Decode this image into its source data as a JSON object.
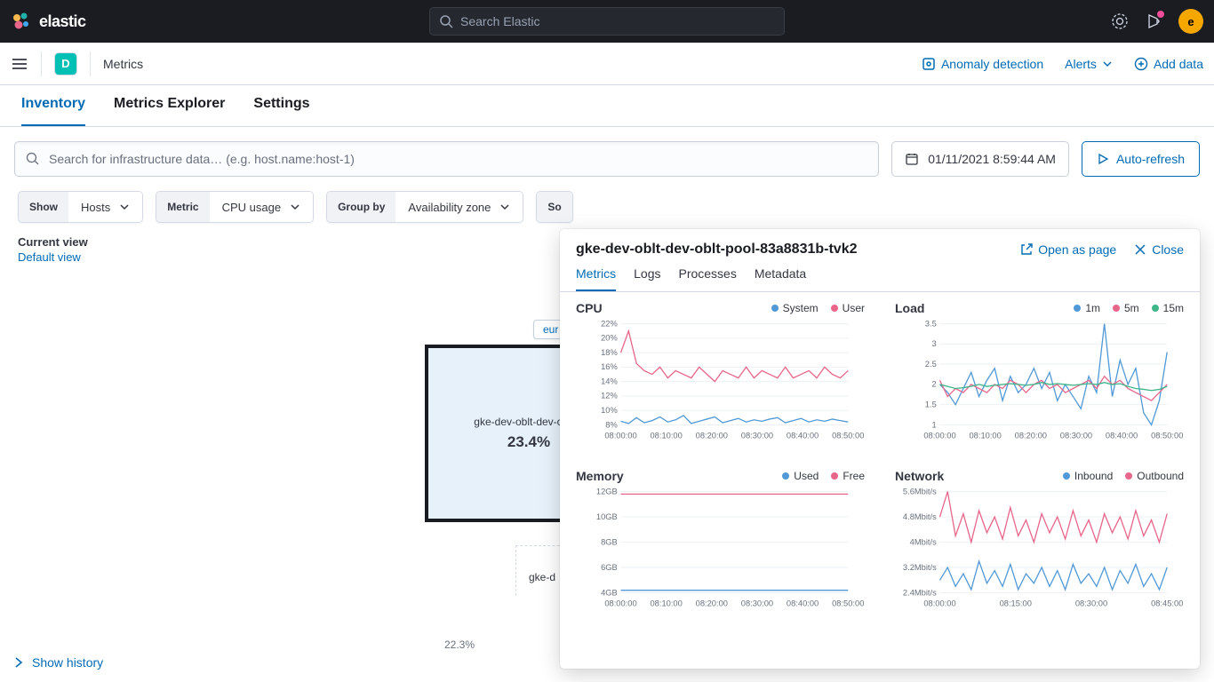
{
  "header": {
    "brand": "elastic",
    "search_placeholder": "Search Elastic",
    "avatar_letter": "e"
  },
  "subheader": {
    "space_letter": "D",
    "breadcrumb": "Metrics",
    "anomaly": "Anomaly detection",
    "alerts": "Alerts",
    "add_data": "Add data"
  },
  "tabs": {
    "inventory": "Inventory",
    "explorer": "Metrics Explorer",
    "settings": "Settings"
  },
  "filter": {
    "search_placeholder": "Search for infrastructure data… (e.g. host.name:host-1)",
    "date": "01/11/2021 8:59:44 AM",
    "refresh": "Auto-refresh"
  },
  "controls": {
    "show_label": "Show",
    "show_value": "Hosts",
    "metric_label": "Metric",
    "metric_value": "CPU usage",
    "group_label": "Group by",
    "group_value": "Availability zone",
    "sort_label": "So"
  },
  "view": {
    "label": "Current view",
    "link": "Default view"
  },
  "waffle": {
    "zone": "eur",
    "node_name": "gke-dev-oblt-dev-oblt-p",
    "node_value": "23.4%",
    "node2_name": "gke-d",
    "pct2": "22.3%"
  },
  "history": "Show history",
  "flyout": {
    "title": "gke-dev-oblt-dev-oblt-pool-83a8831b-tvk2",
    "open": "Open as page",
    "close": "Close",
    "tabs": {
      "metrics": "Metrics",
      "logs": "Logs",
      "processes": "Processes",
      "metadata": "Metadata"
    },
    "cpu": {
      "title": "CPU",
      "legend": [
        "System",
        "User"
      ]
    },
    "load": {
      "title": "Load",
      "legend": [
        "1m",
        "5m",
        "15m"
      ]
    },
    "memory": {
      "title": "Memory",
      "legend": [
        "Used",
        "Free"
      ]
    },
    "network": {
      "title": "Network",
      "legend": [
        "Inbound",
        "Outbound"
      ]
    }
  },
  "colors": {
    "blue": "#5199d6",
    "pink": "#e7668a",
    "green": "#3fb58a"
  },
  "chart_data": [
    {
      "type": "line",
      "title": "CPU",
      "xlabel": "",
      "ylabel": "",
      "x_ticks": [
        "08:00:00",
        "08:10:00",
        "08:20:00",
        "08:30:00",
        "08:40:00",
        "08:50:00"
      ],
      "y_ticks": [
        "8%",
        "10%",
        "12%",
        "14%",
        "16%",
        "18%",
        "20%",
        "22%"
      ],
      "ylim": [
        8,
        22
      ],
      "series": [
        {
          "name": "System",
          "color": "#5199d6",
          "values": [
            8.5,
            8.2,
            9.0,
            8.3,
            8.6,
            9.1,
            8.4,
            8.7,
            9.3,
            8.2,
            8.5,
            8.8,
            9.1,
            8.3,
            8.6,
            8.9,
            8.4,
            8.7,
            8.5,
            8.8,
            9.0,
            8.3,
            8.6,
            8.9,
            8.4,
            8.7,
            8.5,
            8.8,
            8.6,
            8.4
          ]
        },
        {
          "name": "User",
          "color": "#e7668a",
          "values": [
            18,
            21,
            16.5,
            15.5,
            15,
            16,
            14.5,
            15.5,
            15,
            14.5,
            16,
            15,
            14,
            15.5,
            15,
            14.5,
            16,
            14.5,
            15.5,
            15,
            14.5,
            16,
            14.5,
            15,
            15.5,
            14.5,
            16,
            15,
            14.5,
            15.5
          ]
        }
      ]
    },
    {
      "type": "line",
      "title": "Load",
      "xlabel": "",
      "ylabel": "",
      "x_ticks": [
        "08:00:00",
        "08:10:00",
        "08:20:00",
        "08:30:00",
        "08:40:00",
        "08:50:00"
      ],
      "y_ticks": [
        "1",
        "1.5",
        "2",
        "2.5",
        "3",
        "3.5"
      ],
      "ylim": [
        1,
        3.5
      ],
      "series": [
        {
          "name": "1m",
          "color": "#5199d6",
          "values": [
            2.0,
            1.8,
            1.5,
            1.9,
            2.3,
            1.7,
            2.1,
            2.4,
            1.6,
            2.2,
            1.8,
            2.0,
            2.4,
            1.9,
            2.3,
            1.6,
            2.0,
            1.7,
            1.4,
            2.2,
            1.8,
            3.5,
            1.7,
            2.6,
            2.0,
            2.4,
            1.3,
            1.0,
            1.6,
            2.8
          ]
        },
        {
          "name": "5m",
          "color": "#e7668a",
          "values": [
            2.1,
            1.7,
            1.9,
            1.8,
            2.0,
            1.9,
            1.8,
            2.0,
            1.9,
            2.1,
            2.0,
            1.8,
            2.0,
            2.1,
            1.9,
            2.0,
            1.8,
            1.9,
            2.0,
            2.1,
            1.9,
            2.2,
            2.0,
            2.1,
            1.9,
            1.8,
            1.7,
            1.6,
            1.8,
            2.0
          ]
        },
        {
          "name": "15m",
          "color": "#3fb58a",
          "values": [
            2.0,
            1.95,
            1.9,
            1.92,
            1.95,
            2.0,
            1.95,
            1.98,
            2.0,
            2.02,
            2.0,
            1.98,
            2.0,
            2.05,
            2.0,
            2.02,
            2.0,
            1.98,
            2.0,
            2.02,
            2.0,
            2.05,
            2.0,
            2.02,
            1.95,
            1.9,
            1.88,
            1.85,
            1.88,
            1.95
          ]
        }
      ]
    },
    {
      "type": "line",
      "title": "Memory",
      "xlabel": "",
      "ylabel": "",
      "x_ticks": [
        "08:00:00",
        "08:10:00",
        "08:20:00",
        "08:30:00",
        "08:40:00",
        "08:50:00"
      ],
      "y_ticks": [
        "4GB",
        "6GB",
        "8GB",
        "10GB",
        "12GB"
      ],
      "ylim": [
        4,
        12
      ],
      "series": [
        {
          "name": "Used",
          "color": "#5199d6",
          "values": [
            4.2,
            4.2,
            4.2,
            4.2,
            4.2,
            4.2,
            4.2,
            4.2,
            4.2,
            4.2,
            4.2,
            4.2,
            4.2,
            4.2,
            4.2,
            4.2,
            4.2,
            4.2,
            4.2,
            4.2
          ]
        },
        {
          "name": "Free",
          "color": "#e7668a",
          "values": [
            11.8,
            11.8,
            11.8,
            11.8,
            11.8,
            11.8,
            11.8,
            11.8,
            11.8,
            11.8,
            11.8,
            11.8,
            11.8,
            11.8,
            11.8,
            11.8,
            11.8,
            11.8,
            11.8,
            11.8
          ]
        }
      ]
    },
    {
      "type": "line",
      "title": "Network",
      "xlabel": "",
      "ylabel": "",
      "x_ticks": [
        "08:00:00",
        "08:15:00",
        "08:30:00",
        "08:45:00"
      ],
      "y_ticks": [
        "2.4Mbit/s",
        "3.2Mbit/s",
        "4Mbit/s",
        "4.8Mbit/s",
        "5.6Mbit/s"
      ],
      "ylim": [
        2.4,
        5.6
      ],
      "series": [
        {
          "name": "Inbound",
          "color": "#5199d6",
          "values": [
            2.8,
            3.2,
            2.6,
            3.0,
            2.5,
            3.4,
            2.7,
            3.1,
            2.6,
            3.3,
            2.5,
            3.0,
            2.7,
            3.2,
            2.6,
            3.1,
            2.5,
            3.3,
            2.7,
            3.0,
            2.6,
            3.2,
            2.5,
            3.1,
            2.7,
            3.3,
            2.6,
            3.0,
            2.5,
            3.2
          ]
        },
        {
          "name": "Outbound",
          "color": "#e7668a",
          "values": [
            4.8,
            5.6,
            4.2,
            4.9,
            4.0,
            5.0,
            4.3,
            4.8,
            4.1,
            5.1,
            4.2,
            4.7,
            4.0,
            4.9,
            4.3,
            4.8,
            4.1,
            5.0,
            4.2,
            4.7,
            4.0,
            4.9,
            4.3,
            4.8,
            4.1,
            5.0,
            4.2,
            4.7,
            4.0,
            4.9
          ]
        }
      ]
    }
  ]
}
